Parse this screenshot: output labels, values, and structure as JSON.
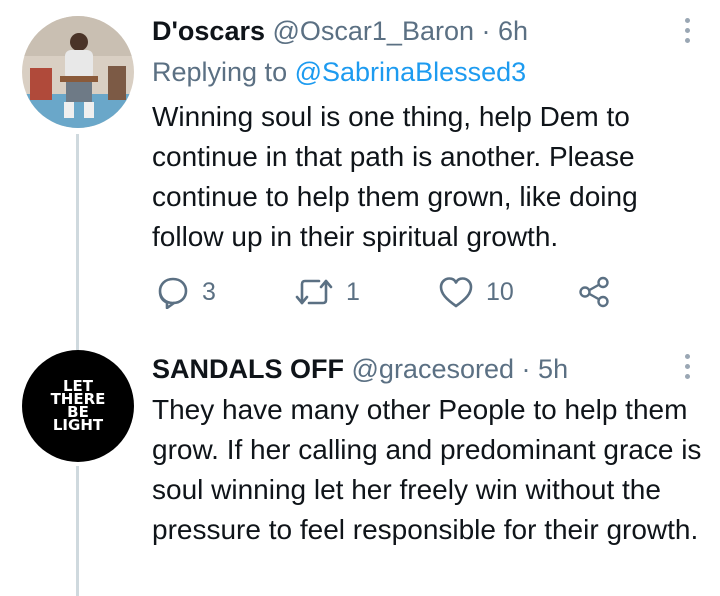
{
  "tweets": [
    {
      "name": "D'oscars",
      "handle": "@Oscar1_Baron",
      "separator": "·",
      "time": "6h",
      "replying_prefix": "Replying to",
      "replying_to": "@SabrinaBlessed3",
      "text": "Winning soul is one thing, help Dem to continue in that path is another. Please continue to help them grown, like doing follow up in their spiritual growth.",
      "actions": {
        "replies": "3",
        "retweets": "1",
        "likes": "10"
      }
    },
    {
      "name": "SANDALS OFF",
      "handle": "@gracesored",
      "separator": "·",
      "time": "5h",
      "text": "They have many other People to help them grow. If her calling and predominant grace is soul winning let her freely win without the pressure to feel responsible for their growth.",
      "avatar_logo": "LET THERE BE LIGHT"
    }
  ],
  "icons": {
    "reply": "reply-icon",
    "retweet": "retweet-icon",
    "like": "heart-icon",
    "share": "share-icon",
    "more": "more-vertical-icon"
  },
  "colors": {
    "link": "#1d9bf0",
    "secondary_text": "#5b7083",
    "thread_line": "#cfd9de"
  }
}
